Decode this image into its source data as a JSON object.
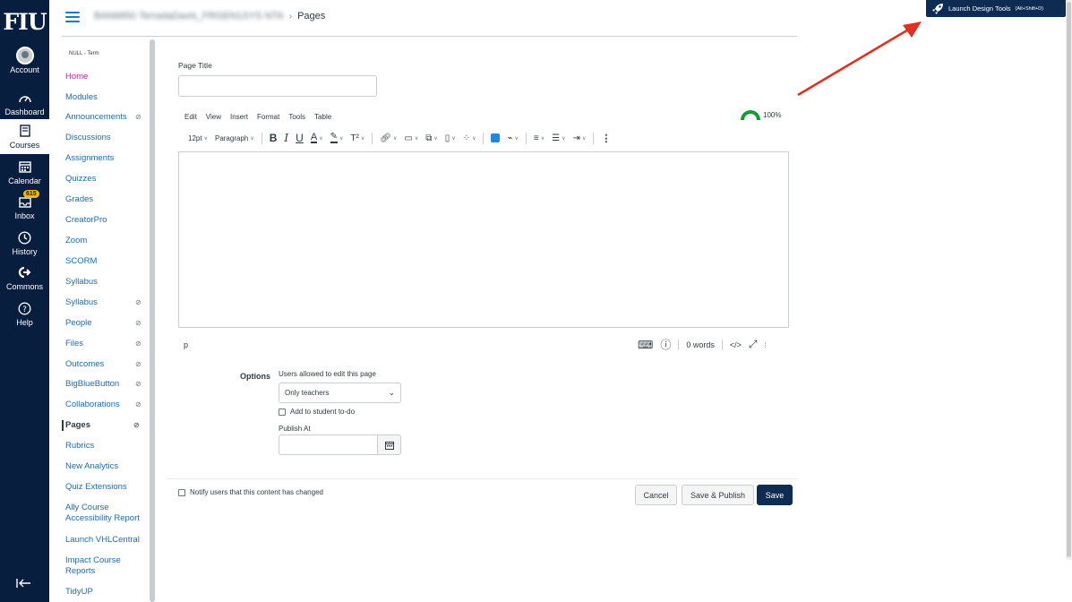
{
  "global_nav": {
    "logo": "FIU",
    "items": [
      {
        "label": "Account",
        "icon": "avatar"
      },
      {
        "label": "Dashboard",
        "icon": "dashboard-icon"
      },
      {
        "label": "Courses",
        "icon": "book-icon",
        "active": true
      },
      {
        "label": "Calendar",
        "icon": "calendar-icon"
      },
      {
        "label": "Inbox",
        "icon": "inbox-icon",
        "badge": "615"
      },
      {
        "label": "History",
        "icon": "clock-icon"
      },
      {
        "label": "Commons",
        "icon": "commons-icon"
      },
      {
        "label": "Help",
        "icon": "help-icon"
      }
    ]
  },
  "header": {
    "course_name": "BAN6850 TerradaDavis_FRGEN1SYS NTA",
    "separator": "›",
    "page": "Pages"
  },
  "course_nav": {
    "term": "NULL - Term",
    "items": [
      {
        "label": "Home",
        "hidden": false
      },
      {
        "label": "Modules",
        "hidden": false
      },
      {
        "label": "Announcements",
        "hidden": true
      },
      {
        "label": "Discussions",
        "hidden": false
      },
      {
        "label": "Assignments",
        "hidden": false
      },
      {
        "label": "Quizzes",
        "hidden": false
      },
      {
        "label": "Grades",
        "hidden": false
      },
      {
        "label": "CreatorPro",
        "hidden": false
      },
      {
        "label": "Zoom",
        "hidden": false
      },
      {
        "label": "SCORM",
        "hidden": false
      },
      {
        "label": "Syllabus",
        "hidden": false
      },
      {
        "label": "Syllabus",
        "hidden": true
      },
      {
        "label": "People",
        "hidden": true
      },
      {
        "label": "Files",
        "hidden": true
      },
      {
        "label": "Outcomes",
        "hidden": true
      },
      {
        "label": "BigBlueButton",
        "hidden": true
      },
      {
        "label": "Collaborations",
        "hidden": true
      },
      {
        "label": "Pages",
        "hidden": true,
        "active": true
      },
      {
        "label": "Rubrics",
        "hidden": false
      },
      {
        "label": "New Analytics",
        "hidden": false
      },
      {
        "label": "Quiz Extensions",
        "hidden": false
      },
      {
        "label": "Ally Course Accessibility Report",
        "hidden": false
      },
      {
        "label": "Launch VHLCentral",
        "hidden": false
      },
      {
        "label": "Impact Course Reports",
        "hidden": false
      },
      {
        "label": "TidyUP",
        "hidden": false
      }
    ]
  },
  "editor": {
    "page_title_label": "Page Title",
    "page_title_value": "",
    "menu": [
      "Edit",
      "View",
      "Insert",
      "Format",
      "Tools",
      "Table"
    ],
    "accessibility_score": "100%",
    "font_size": "12pt",
    "block_format": "Paragraph",
    "status_path": "p",
    "word_count": "0 words",
    "html_toggle": "</>"
  },
  "options": {
    "label": "Options",
    "edit_label": "Users allowed to edit this page",
    "edit_value": "Only teachers",
    "todo_label": "Add to student to-do",
    "publish_at_label": "Publish At",
    "publish_at_value": ""
  },
  "footer": {
    "notify_label": "Notify users that this content has changed",
    "cancel": "Cancel",
    "save_publish": "Save & Publish",
    "save": "Save"
  },
  "launch_design_tools": {
    "label": "Launch Design Tools",
    "shortcut": "(Alt+Shift+D)"
  },
  "colors": {
    "nav_bg": "#081E3F",
    "primary_button": "#0E2B52",
    "link": "#1b6ab8",
    "home_link": "#b1268c",
    "badge": "#F5B800",
    "arrow": "#e0311f"
  }
}
